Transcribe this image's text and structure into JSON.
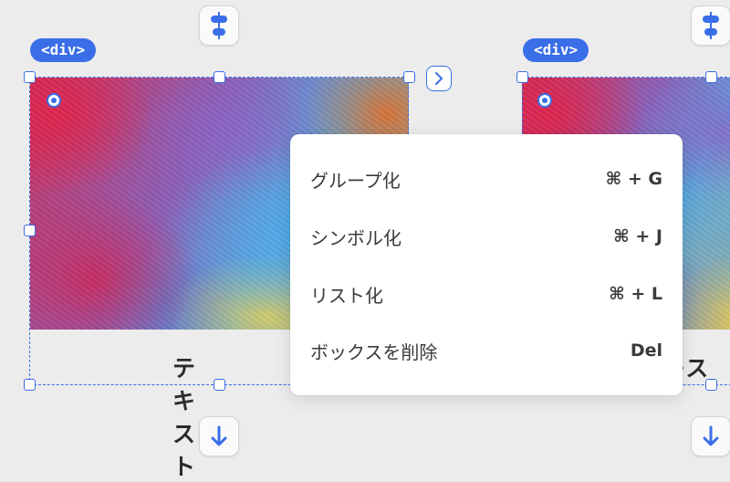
{
  "left_card": {
    "tag": "<div>",
    "caption": "テキスト"
  },
  "right_card": {
    "tag": "<div>",
    "caption": "テキスト"
  },
  "context_menu": {
    "items": [
      {
        "label": "グループ化",
        "shortcut": "⌘ + G"
      },
      {
        "label": "シンボル化",
        "shortcut": "⌘ + J"
      },
      {
        "label": "リスト化",
        "shortcut": "⌘ + L"
      },
      {
        "label": "ボックスを削除",
        "shortcut": "Del"
      }
    ]
  },
  "icons": {
    "top_button": "align-vertical-center-icon",
    "bottom_button": "arrow-down-icon",
    "side_button": "chevron-right-icon"
  },
  "colors": {
    "accent": "#3a6ee8",
    "background": "#ececec",
    "menu_bg": "#ffffff"
  }
}
